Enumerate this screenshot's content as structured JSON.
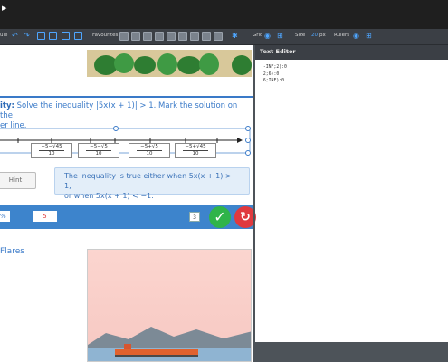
{
  "topbar": {
    "play_glyph": "▶"
  },
  "toolbar": {
    "module_label": "ule",
    "undo_glyph": "↶",
    "redo_glyph": "↷",
    "favourites_label": "Favourites",
    "grid_label": "Grid",
    "size_label": "Size",
    "size_value": "20",
    "size_unit": "px",
    "rulers_label": "Rulers",
    "accent_color": "#4ea6ff"
  },
  "exercise": {
    "lead_bold": "ity:",
    "line1": "Solve the inequality |5x(x + 1)| > 1. Mark the solution on the",
    "line2": "er line.",
    "fractions": [
      {
        "num": "−5−√45",
        "den": "10"
      },
      {
        "num": "−5−√5",
        "den": "10"
      },
      {
        "num": "−5+√5",
        "den": "10"
      },
      {
        "num": "−5+√45",
        "den": "10"
      }
    ],
    "hint_label": "Hint",
    "answer_line1": "The inequality is true either when 5x(x + 1) > 1,",
    "answer_line2": "or when 5x(x + 1) < −1.",
    "percent_value": "%",
    "score_value": "5",
    "counter_value": "3",
    "check_glyph": "✓",
    "reset_glyph": "↻"
  },
  "next_section": {
    "title": "Flares"
  },
  "text_editor": {
    "title": "Text Editor",
    "lines": [
      "(-INF;2):0",
      "(2;6):0",
      "(6;INF):0"
    ]
  }
}
